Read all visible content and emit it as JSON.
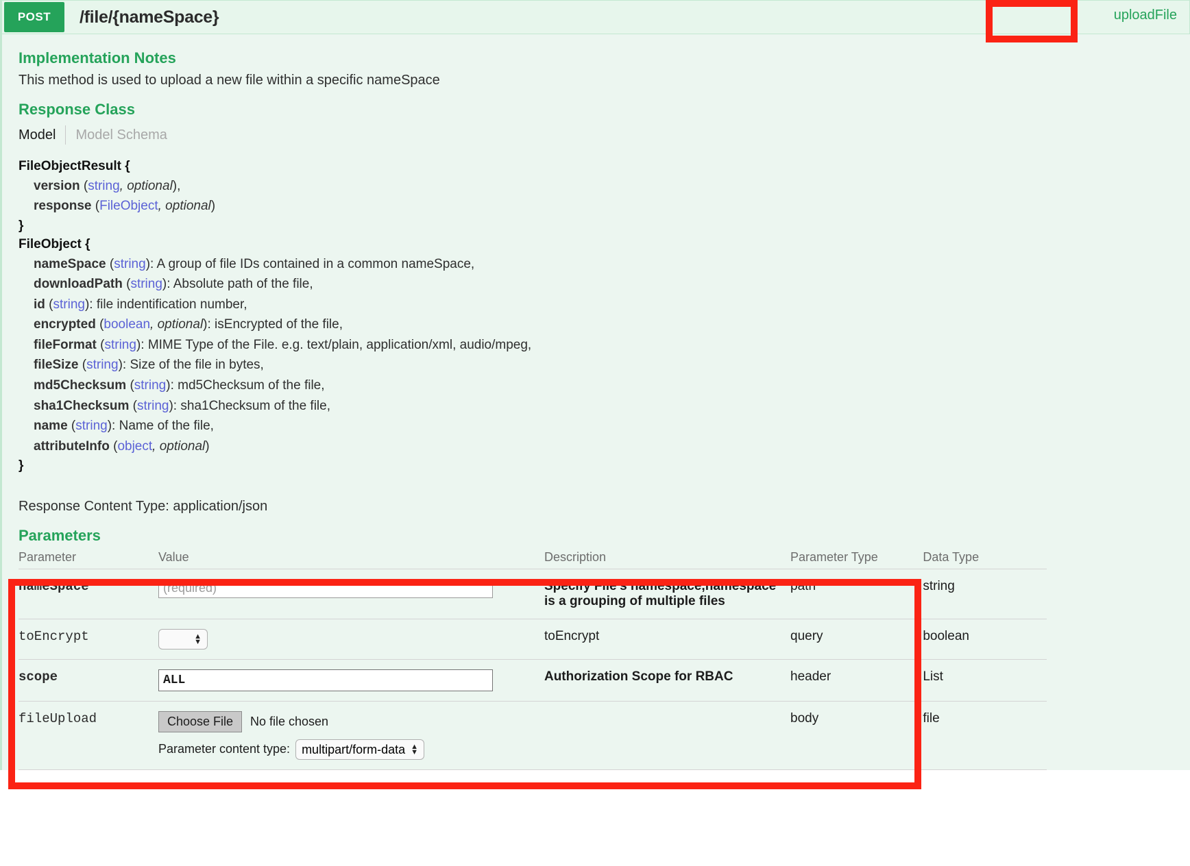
{
  "operation": {
    "method": "POST",
    "path": "/file/{nameSpace}",
    "nickname": "uploadFile"
  },
  "implementation_notes": {
    "heading": "Implementation Notes",
    "text": "This method is used to upload a new file within a specific nameSpace"
  },
  "response_class": {
    "heading": "Response Class",
    "tabs": {
      "model": "Model",
      "model_schema": "Model Schema"
    },
    "models": [
      {
        "name": "FileObjectResult {",
        "close": "}",
        "properties": [
          {
            "name": "version",
            "type": "string",
            "optional": ", optional",
            "tail": "),",
            "desc": ""
          },
          {
            "name": "response",
            "type": "FileObject",
            "optional": ", optional",
            "tail": ")",
            "desc": ""
          }
        ]
      },
      {
        "name": "FileObject {",
        "close": "}",
        "properties": [
          {
            "name": "nameSpace",
            "type": "string",
            "optional": "",
            "tail": "):",
            "desc": " A group of file IDs contained in a common nameSpace,"
          },
          {
            "name": "downloadPath",
            "type": "string",
            "optional": "",
            "tail": "):",
            "desc": " Absolute path of the file,"
          },
          {
            "name": "id",
            "type": "string",
            "optional": "",
            "tail": "):",
            "desc": " file indentification number,"
          },
          {
            "name": "encrypted",
            "type": "boolean",
            "optional": ", optional",
            "tail": "):",
            "desc": " isEncrypted of the file,"
          },
          {
            "name": "fileFormat",
            "type": "string",
            "optional": "",
            "tail": "):",
            "desc": " MIME Type of the File. e.g. text/plain, application/xml, audio/mpeg,"
          },
          {
            "name": "fileSize",
            "type": "string",
            "optional": "",
            "tail": "):",
            "desc": " Size of the file in bytes,"
          },
          {
            "name": "md5Checksum",
            "type": "string",
            "optional": "",
            "tail": "):",
            "desc": " md5Checksum of the file,"
          },
          {
            "name": "sha1Checksum",
            "type": "string",
            "optional": "",
            "tail": "):",
            "desc": " sha1Checksum of the file,"
          },
          {
            "name": "name",
            "type": "string",
            "optional": "",
            "tail": "):",
            "desc": " Name of the file,"
          },
          {
            "name": "attributeInfo",
            "type": "object",
            "optional": ", optional",
            "tail": ")",
            "desc": ""
          }
        ]
      }
    ]
  },
  "response_content_type": {
    "label": "Response Content Type: application/json"
  },
  "parameters": {
    "heading": "Parameters",
    "columns": {
      "parameter": "Parameter",
      "value": "Value",
      "description": "Description",
      "parameter_type": "Parameter Type",
      "data_type": "Data Type"
    },
    "rows": [
      {
        "name": "nameSpace",
        "required": true,
        "control": "text",
        "placeholder": "(required)",
        "value": "",
        "description": "Specify File's namespace,namespace is a grouping of multiple files",
        "parameter_type": "path",
        "data_type": "string"
      },
      {
        "name": "toEncrypt",
        "required": false,
        "control": "select",
        "selected": "",
        "options": [
          "",
          "true",
          "false"
        ],
        "description": "toEncrypt",
        "parameter_type": "query",
        "data_type": "boolean"
      },
      {
        "name": "scope",
        "required": true,
        "control": "text",
        "placeholder": "",
        "value": "ALL",
        "description": "Authorization Scope for RBAC",
        "parameter_type": "header",
        "data_type": "List"
      },
      {
        "name": "fileUpload",
        "required": false,
        "control": "file",
        "choose_file_label": "Choose File",
        "no_file_text": "No file chosen",
        "content_type_label": "Parameter content type:",
        "content_type_selected": "multipart/form-data",
        "content_type_options": [
          "multipart/form-data"
        ],
        "description": "",
        "parameter_type": "body",
        "data_type": "file"
      }
    ]
  },
  "annotations": {
    "highlight_color": "#fb2314",
    "boxes": [
      "uploadFile-link",
      "parameters-table-rows"
    ]
  },
  "colors": {
    "method_badge": "#25a35a",
    "section_heading": "#25a35a",
    "panel_background": "#ecf6f0",
    "type_link": "#5b62d6"
  }
}
